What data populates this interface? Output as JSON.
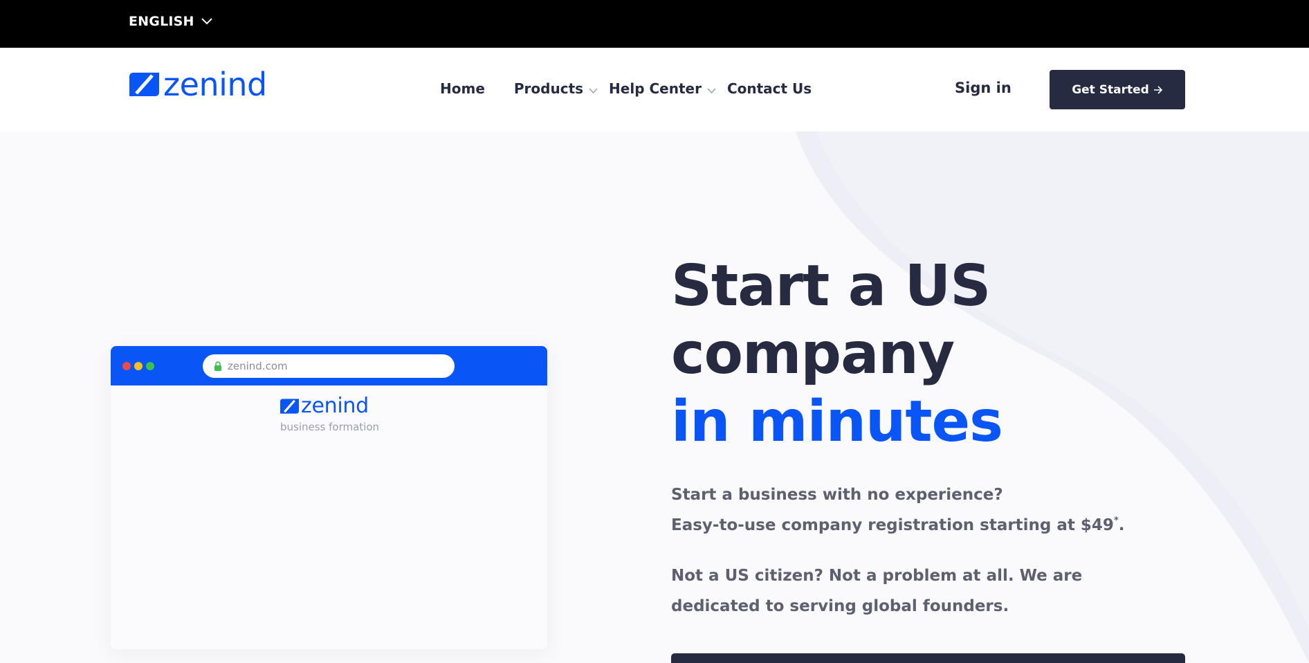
{
  "topbar": {
    "language": "ENGLISH"
  },
  "header": {
    "logo_text": "zenind",
    "nav": {
      "home": "Home",
      "products": "Products",
      "help_center": "Help Center",
      "contact_us": "Contact Us"
    },
    "sign_in": "Sign in",
    "get_started": "Get Started"
  },
  "mockup": {
    "url": "zenind.com",
    "logo_text": "zenind",
    "subtitle": "business formation"
  },
  "hero": {
    "headline_line1": "Start a US",
    "headline_line2": "company",
    "headline_line3": "in minutes",
    "sub_line1": "Start a business with no experience?",
    "sub_line2": "Easy-to-use company registration starting at $49",
    "sub_asterisk": "*",
    "sub_period": ".",
    "para2": "Not a US citizen? Not a problem at all. We are dedicated to serving global founders."
  },
  "colors": {
    "brand_blue": "#0a55f5",
    "dark_navy": "#262b42",
    "body_gray": "#5c606f"
  },
  "icons": [
    "chevron-down-icon",
    "logo-mark-icon",
    "arrow-right-icon",
    "lock-icon"
  ]
}
